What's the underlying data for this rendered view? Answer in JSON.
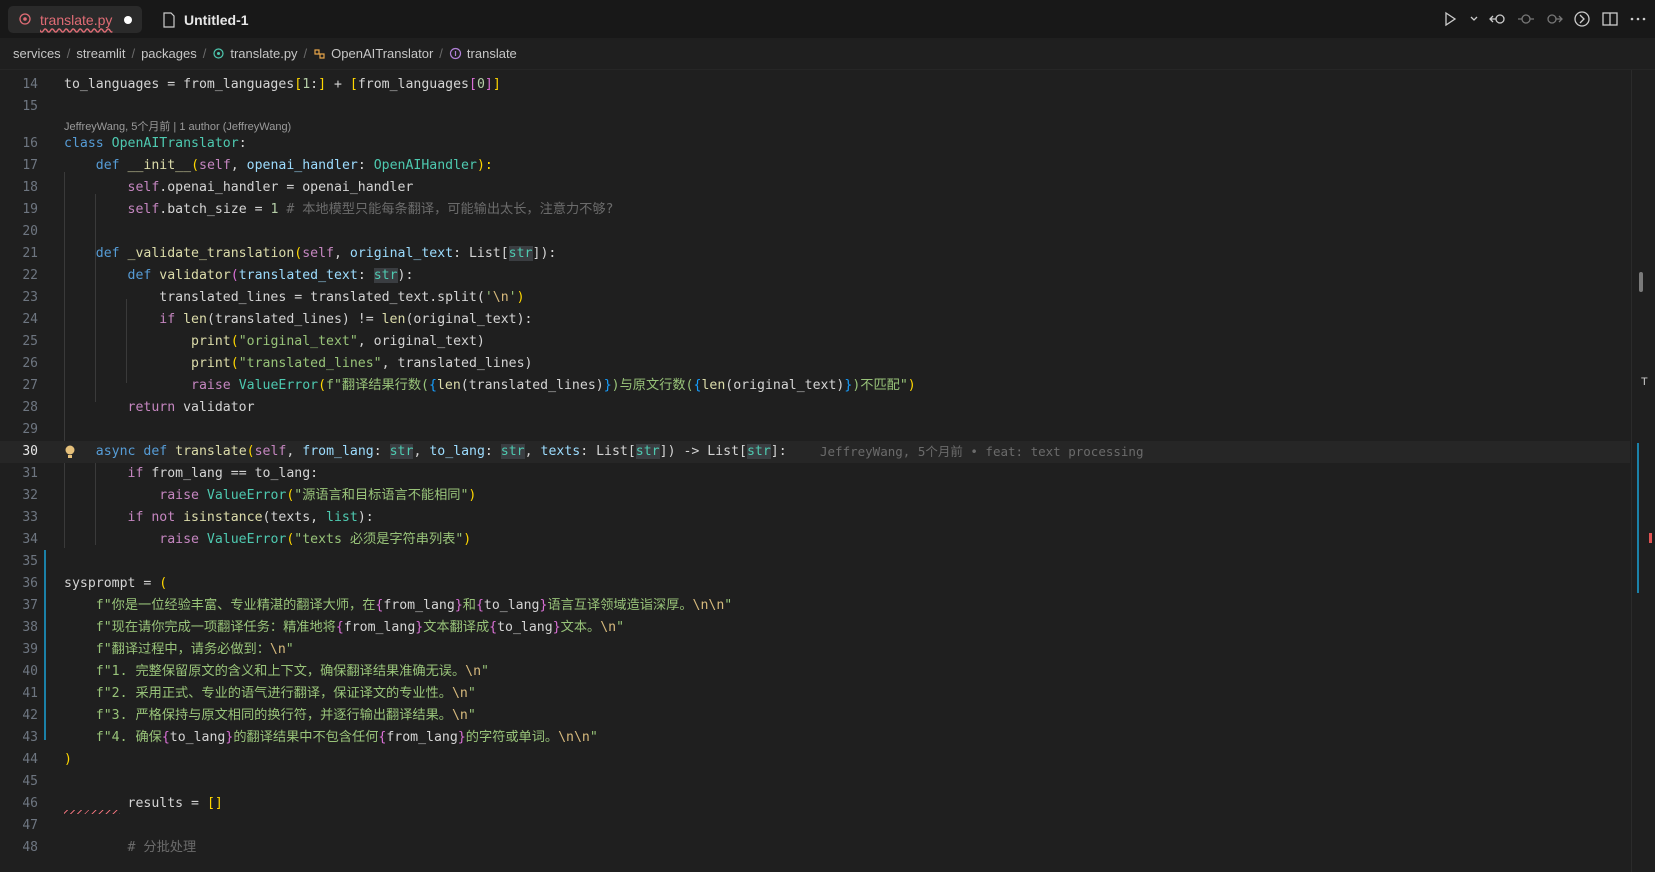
{
  "tabs": [
    {
      "label": "translate.py",
      "active": true,
      "modified": true
    },
    {
      "label": "Untitled-1",
      "active": false
    }
  ],
  "breadcrumb": [
    "services",
    "streamlit",
    "packages",
    "translate.py",
    "OpenAITranslator",
    "translate"
  ],
  "blame_header": "JeffreyWang, 5个月前 | 1 author (JeffreyWang)",
  "inline_blame": "JeffreyWang, 5个月前 • feat: text processing",
  "current_line": 30,
  "line_numbers": [
    "14",
    "15",
    "16",
    "17",
    "18",
    "19",
    "20",
    "21",
    "22",
    "23",
    "24",
    "25",
    "26",
    "27",
    "28",
    "29",
    "30",
    "31",
    "32",
    "33",
    "34",
    "35",
    "36",
    "37",
    "38",
    "39",
    "40",
    "41",
    "42",
    "43",
    "44",
    "45",
    "46",
    "47",
    "48"
  ],
  "code": {
    "l14": [
      "to_languages = from_languages",
      "[",
      "1",
      ":",
      "]",
      " + ",
      "[",
      "from_languages",
      "[",
      "0",
      "]",
      "]"
    ],
    "l16": [
      "class ",
      "OpenAITranslator",
      ":"
    ],
    "l17": [
      "def ",
      "__init__",
      "(",
      "self",
      ", ",
      "openai_handler",
      ": ",
      "OpenAIHandler",
      "):"
    ],
    "l18": [
      "self",
      ".openai_handler = openai_handler"
    ],
    "l19": [
      "self",
      ".batch_size = ",
      "1",
      " # 本地模型只能每条翻译，可能输出太长，注意力不够?"
    ],
    "l21": [
      "def ",
      "_validate_translation",
      "(",
      "self",
      ", ",
      "original_text",
      ": List[",
      "str",
      "]):"
    ],
    "l22": [
      "def ",
      "validator",
      "(",
      "translated_text",
      ": ",
      "str",
      "):"
    ],
    "l23": [
      "translated_lines = translated_text.split(",
      "'",
      "\\n",
      "'",
      ")"
    ],
    "l24": [
      "if ",
      "len",
      "(translated_lines) != ",
      "len",
      "(original_text):"
    ],
    "l25": [
      "print",
      "(",
      "\"original_text\"",
      ", original_text)"
    ],
    "l26": [
      "print",
      "(",
      "\"translated_lines\"",
      ", translated_lines)"
    ],
    "l27": [
      "raise ",
      "ValueError",
      "(",
      "f\"翻译结果行数(",
      "{",
      "len",
      "(translated_lines)",
      "}",
      ")与原文行数(",
      "{",
      "len",
      "(original_text)",
      "}",
      ")不匹配\"",
      ")"
    ],
    "l28": [
      "return ",
      "validator"
    ],
    "l30": [
      "async ",
      "def ",
      "translate",
      "(",
      "self",
      ", ",
      "from_lang",
      ": ",
      "str",
      ", ",
      "to_lang",
      ": ",
      "str",
      ", ",
      "texts",
      ": List[",
      "str",
      "]) -> List[",
      "str",
      "]:"
    ],
    "l31": [
      "if ",
      "from_lang == to_lang:"
    ],
    "l32": [
      "raise ",
      "ValueError",
      "(",
      "\"源语言和目标语言不能相同\"",
      ")"
    ],
    "l33": [
      "if not ",
      "isinstance",
      "(texts, ",
      "list",
      "):"
    ],
    "l34": [
      "raise ",
      "ValueError",
      "(",
      "\"texts 必须是字符串列表\"",
      ")"
    ],
    "l36": [
      "sysprompt = ",
      "("
    ],
    "l37": [
      "f\"你是一位经验丰富、专业精湛的翻译大师，在",
      "{",
      "from_lang",
      "}",
      "和",
      "{",
      "to_lang",
      "}",
      "语言互译领域造诣深厚。",
      "\\n\\n",
      "\""
    ],
    "l38": [
      "f\"现在请你完成一项翻译任务：精准地将",
      "{",
      "from_lang",
      "}",
      "文本翻译成",
      "{",
      "to_lang",
      "}",
      "文本。",
      "\\n",
      "\""
    ],
    "l39": [
      "f\"翻译过程中，请务必做到：",
      "\\n",
      "\""
    ],
    "l40": [
      "f\"1. 完整保留原文的含义和上下文，确保翻译结果准确无误。",
      "\\n",
      "\""
    ],
    "l41": [
      "f\"2. 采用正式、专业的语气进行翻译，保证译文的专业性。",
      "\\n",
      "\""
    ],
    "l42": [
      "f\"3. 严格保持与原文相同的换行符，并逐行输出翻译结果。",
      "\\n",
      "\""
    ],
    "l43": [
      "f\"4. 确保",
      "{",
      "to_lang",
      "}",
      "的翻译结果中不包含任何",
      "{",
      "from_lang",
      "}",
      "的字符或单词。",
      "\\n\\n",
      "\""
    ],
    "l44": [
      ")"
    ],
    "l46": [
      "results = ",
      "[]"
    ],
    "l48": [
      "# 分批处理"
    ]
  },
  "colors": {
    "background": "#1f1f1f",
    "keyword": "#c586c0",
    "function": "#dcdcaa",
    "class": "#4ec9b0",
    "string": "#98c379",
    "modified_tab": "#e06c75"
  },
  "icons": [
    "python-file-icon",
    "file-icon",
    "run-icon",
    "chevron-down-icon",
    "go-back-icon",
    "go-forward-icon",
    "open-changes-icon",
    "git-commit-icon",
    "split-editor-icon",
    "more-icon",
    "class-icon",
    "method-icon",
    "lightbulb-icon"
  ]
}
